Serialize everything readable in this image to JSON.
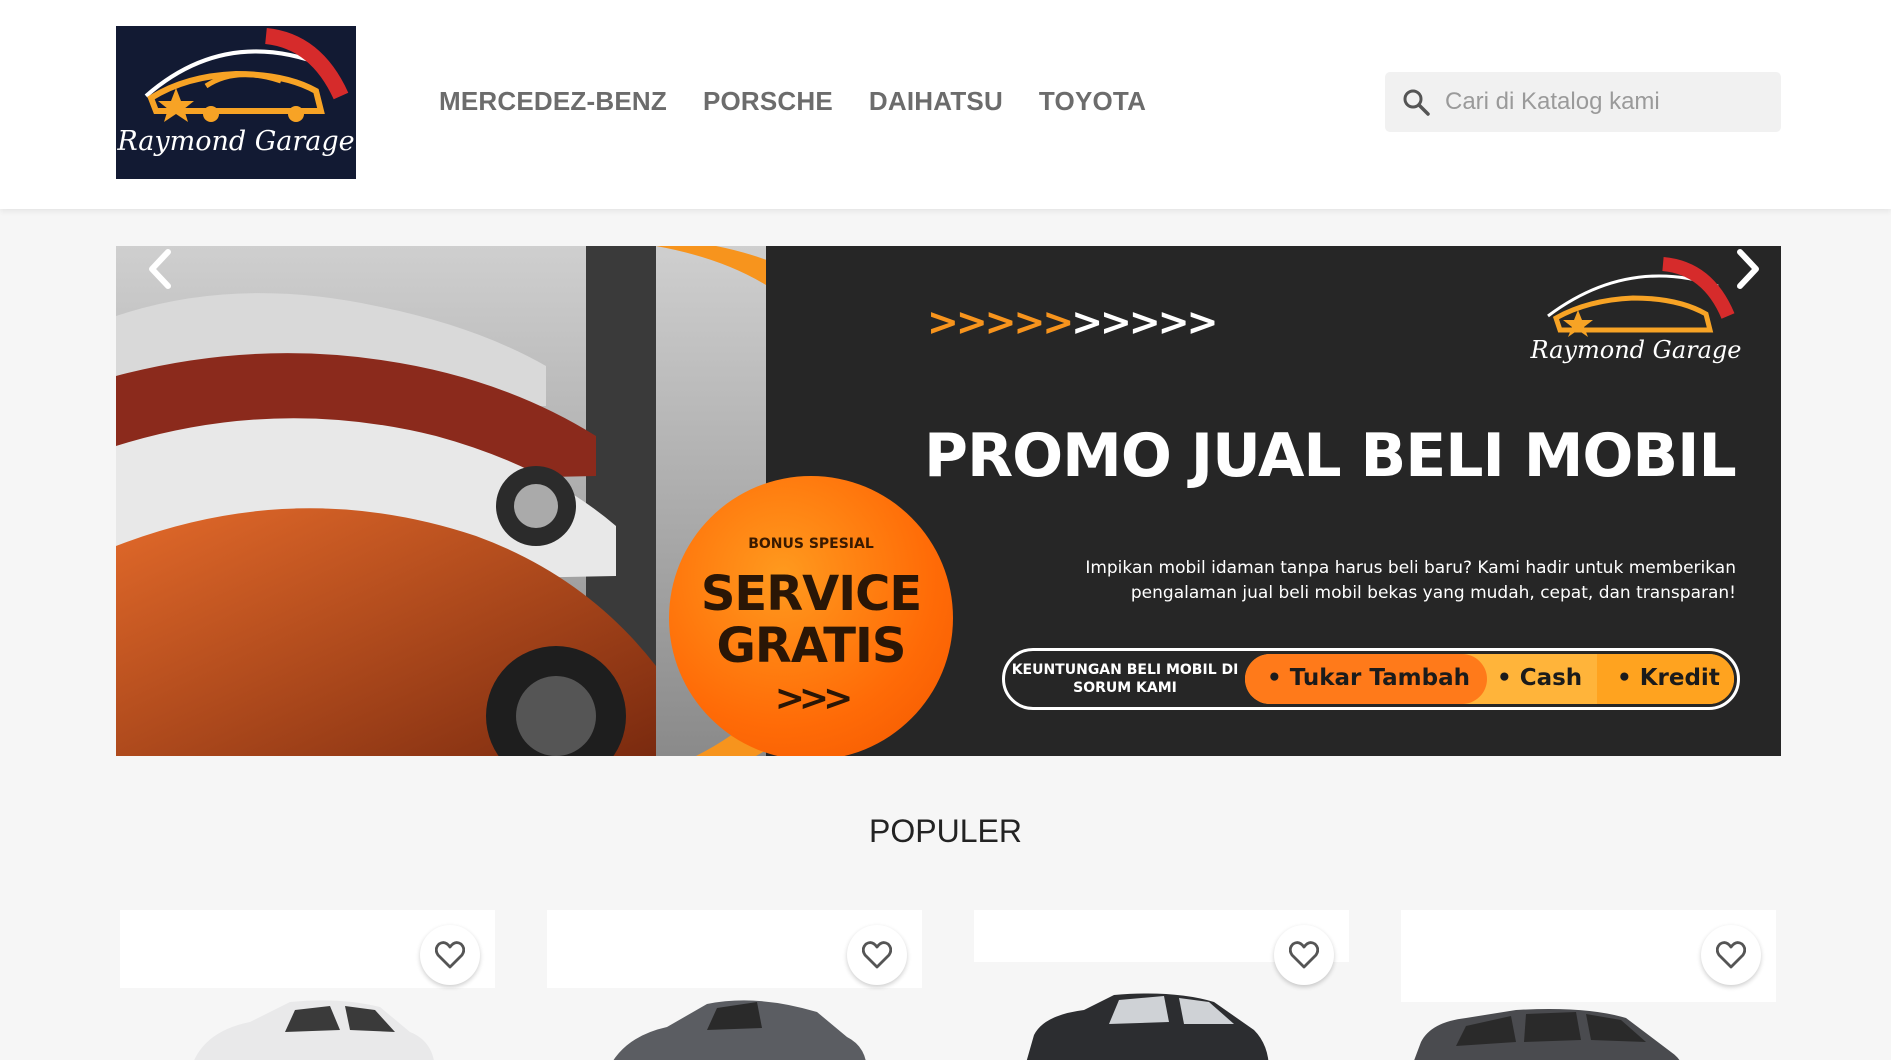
{
  "header": {
    "logo_text": "Raymond Garage",
    "nav": [
      "MERCEDEZ-BENZ",
      "PORSCHE",
      "DAIHATSU",
      "TOYOTA"
    ],
    "search_placeholder": "Cari di Katalog kami",
    "search_icon": "search-icon"
  },
  "banner": {
    "arrows": ">>>>>>>>>>",
    "logo_text": "Raymond Garage",
    "title": "PROMO JUAL BELI MOBIL",
    "description": "Impikan mobil idaman tanpa harus beli baru? Kami hadir untuk memberikan pengalaman jual beli mobil bekas yang mudah, cepat, dan transparan!",
    "badge_top": "BONUS SPESIAL",
    "badge_main": "SERVICE GRATIS",
    "badge_arrows": ">>>",
    "benefits_label": "KEUNTUNGAN BELI MOBIL DI SORUM KAMI",
    "benefits": [
      "• Tukar Tambah",
      "• Cash",
      "• Kredit"
    ],
    "prev_icon": "chevron-left-icon",
    "next_icon": "chevron-right-icon"
  },
  "popular": {
    "title": "POPULER",
    "cards": [
      {
        "favorite_icon": "heart-icon",
        "car_color": "#e9e9ea"
      },
      {
        "favorite_icon": "heart-icon",
        "car_color": "#5b5d62"
      },
      {
        "favorite_icon": "heart-icon",
        "car_color": "#2c2d30"
      },
      {
        "favorite_icon": "heart-icon",
        "car_color": "#4a4b4f"
      }
    ]
  },
  "colors": {
    "accent_orange": "#f7941d",
    "logo_bg": "#121a33",
    "banner_bg": "#262626"
  }
}
